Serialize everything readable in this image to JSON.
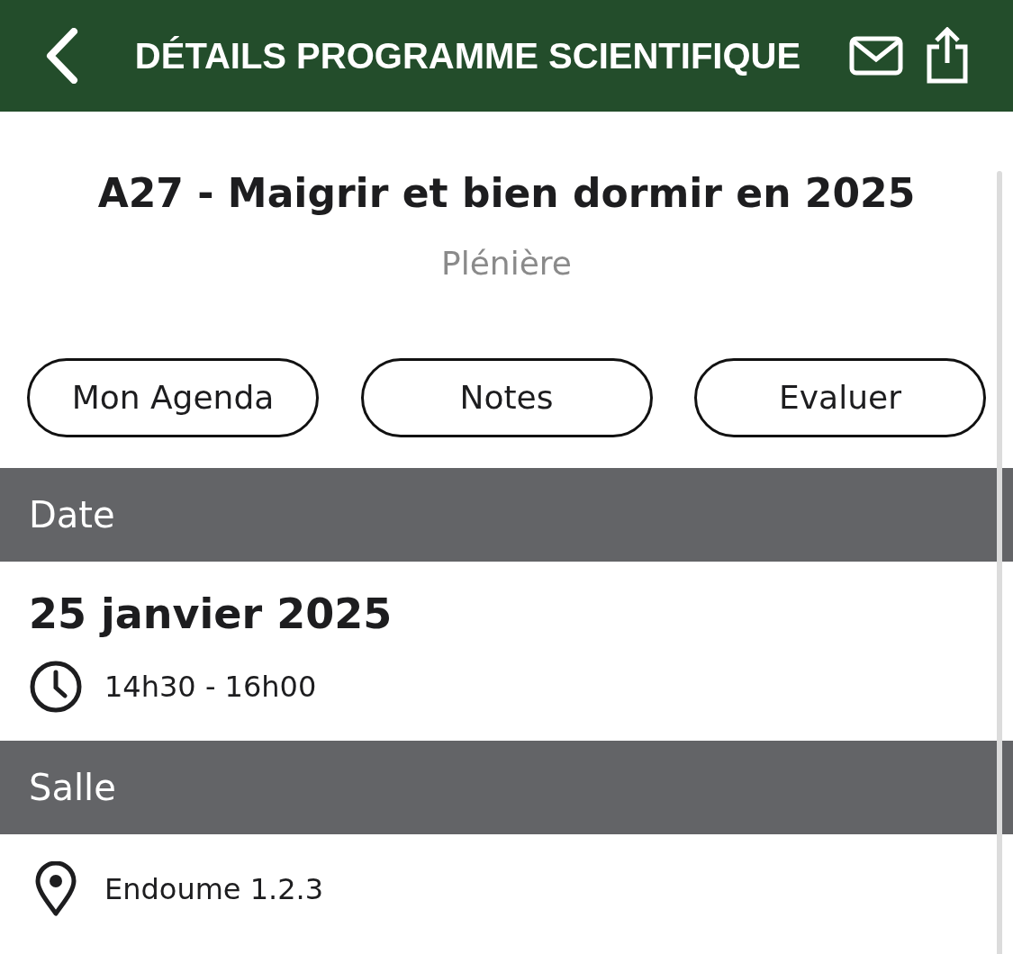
{
  "header": {
    "title": "DÉTAILS PROGRAMME SCIENTIFIQUE"
  },
  "session": {
    "title": "A27 - Maigrir et bien dormir en 2025",
    "type": "Plénière"
  },
  "actions": [
    "Mon Agenda",
    "Notes",
    "Evaluer"
  ],
  "sections": [
    {
      "kind": "date",
      "heading": "Date",
      "value": "25 janvier 2025",
      "detail": "14h30 - 16h00"
    },
    {
      "kind": "room",
      "heading": "Salle",
      "detail": "Endoume 1.2.3"
    }
  ]
}
